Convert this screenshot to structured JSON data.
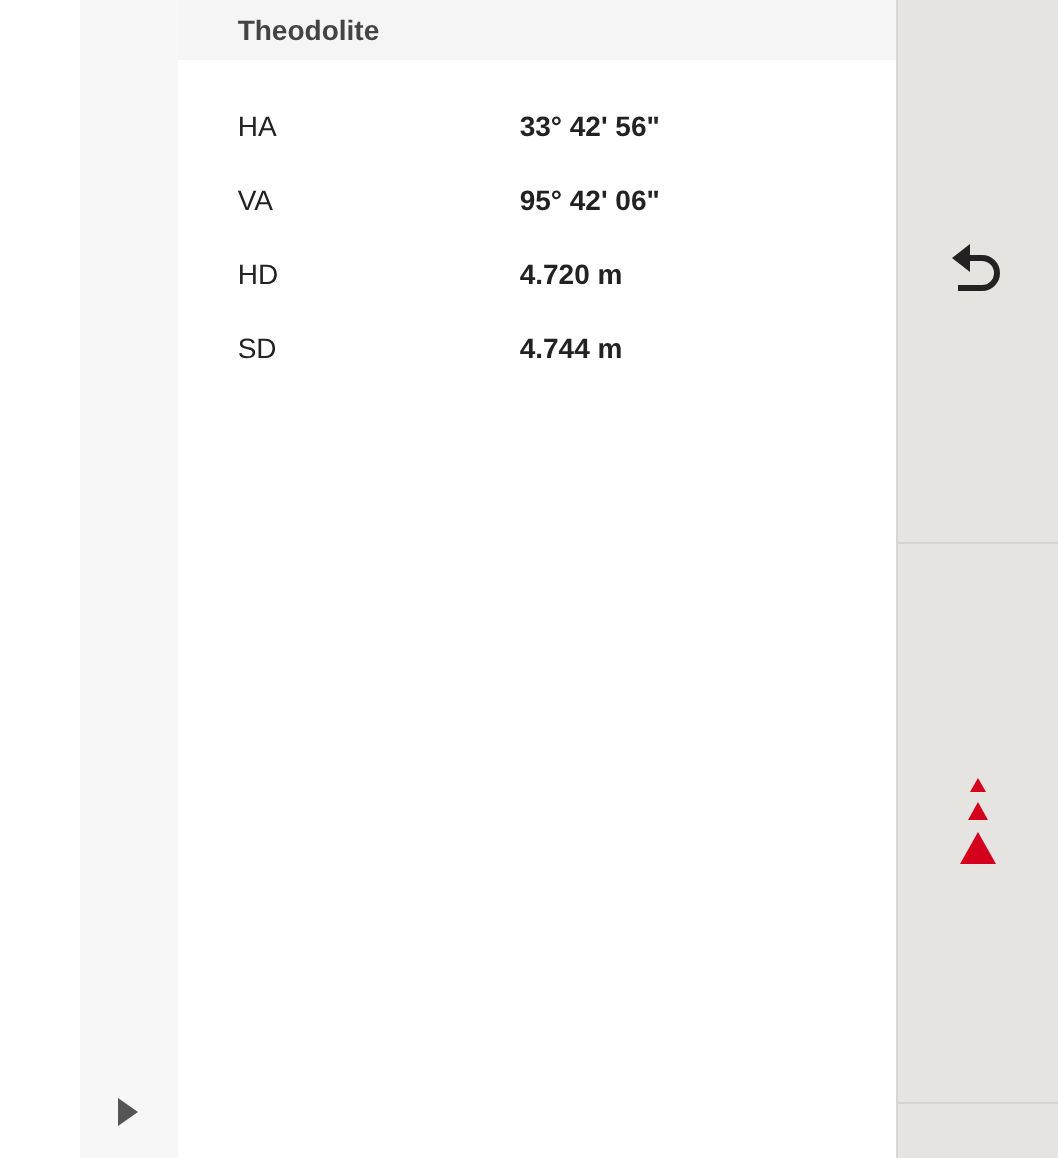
{
  "panel": {
    "title": "Theodolite"
  },
  "measurements": [
    {
      "label": "HA",
      "value": "33° 42' 56\""
    },
    {
      "label": "VA",
      "value": "95° 42' 06\""
    },
    {
      "label": "HD",
      "value": "4.720 m"
    },
    {
      "label": "SD",
      "value": "4.744 m"
    }
  ]
}
